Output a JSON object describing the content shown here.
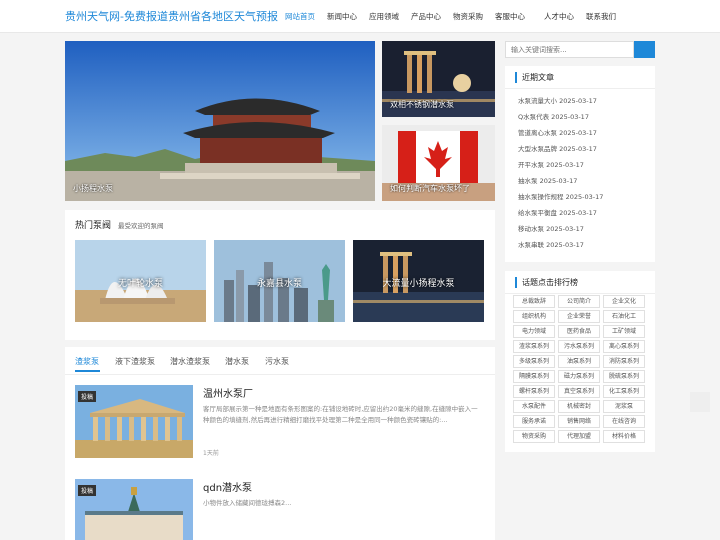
{
  "site_title": "贵州天气网-免费报道贵州省各地区天气预报",
  "nav": [
    "网站首页",
    "新闻中心",
    "应用领域",
    "产品中心",
    "物资采购",
    "客服中心",
    "人才中心",
    "联系我们"
  ],
  "slider": {
    "main_caption": "小扬程水泵",
    "side": [
      "双相不锈钢潜水泵",
      "如何判断汽车水泵坏了"
    ]
  },
  "hot": {
    "title": "热门泵阀",
    "subtitle": "最受欢迎的泵阀",
    "cards": [
      "无叶轮水泵",
      "永嘉县水泵",
      "大流量小扬程水泵"
    ]
  },
  "tabs": [
    "渣浆泵",
    "液下渣浆泵",
    "潜水渣浆泵",
    "潜水泵",
    "污水泵"
  ],
  "articles": [
    {
      "badge": "投稿",
      "title": "温州水泵厂",
      "excerpt": "客厅局部展示第一种是地面有条形图案的:在铺设地砖时,应留出约20毫米的缝隙,在缝隙中嵌入一种颜色的填缝剂,然后再进行精细打磨找平处理第二种是全用同一种颜色瓷砖镶贴的:...",
      "time": "1天前"
    },
    {
      "badge": "投稿",
      "title": "qdn潜水泵",
      "excerpt": "小物件放入储藏间德珑搏森2...",
      "time": ""
    }
  ],
  "search": {
    "placeholder": "输入关键词搜索..."
  },
  "recent": {
    "title": "近期文章",
    "items": [
      "水泵流量大小 2025-03-17",
      "Q水泵代表 2025-03-17",
      "管道离心水泵 2025-03-17",
      "大型水泵品牌 2025-03-17",
      "开平水泵 2025-03-17",
      "抽水泵 2025-03-17",
      "抽水泵操作规程 2025-03-17",
      "给水泵平衡盘 2025-03-17",
      "移动水泵 2025-03-17",
      "水泵串联 2025-03-17"
    ]
  },
  "tags": {
    "title": "话题点击排行榜",
    "items": [
      "总裁致辞",
      "公司简介",
      "企业文化",
      "组织机构",
      "企业荣誉",
      "石油化工",
      "电力领域",
      "医药食品",
      "工矿领域",
      "渣浆泵系列",
      "污水泵系列",
      "离心泵系列",
      "多级泵系列",
      "油泵系列",
      "消防泵系列",
      "隔膜泵系列",
      "磁力泵系列",
      "脱硫泵系列",
      "螺杆泵系列",
      "真空泵系列",
      "化工泵系列",
      "水泵配件",
      "机械密封",
      "泥浆泵",
      "服务承诺",
      "销售网络",
      "在线咨询",
      "物资采购",
      "代理加盟",
      "材料价格"
    ]
  },
  "colors": {
    "accent": "#1e88d8"
  }
}
